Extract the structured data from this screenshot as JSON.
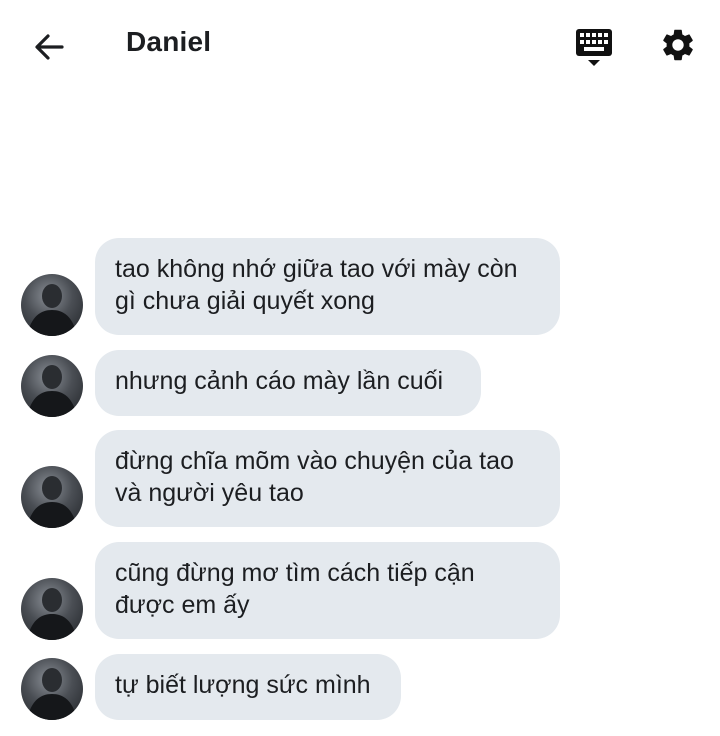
{
  "header": {
    "title": "Daniel"
  },
  "messages": [
    {
      "text": "tao không nhớ giữa tao với mày còn\ngì chưa giải quyết xong"
    },
    {
      "text": "nhưng cảnh cáo mày lần cuối"
    },
    {
      "text": "đừng chĩa mõm vào chuyện của tao\nvà người yêu tao"
    },
    {
      "text": "cũng đừng mơ tìm cách tiếp cận\nđược em ấy"
    },
    {
      "text": "tự biết lượng sức mình"
    }
  ],
  "icons": {
    "back": "arrow-left-icon",
    "keyboard": "keyboard-icon",
    "settings": "gear-icon"
  },
  "colors": {
    "bubble_bg": "#e4e9ee",
    "text": "#1c1e21",
    "background": "#ffffff"
  }
}
